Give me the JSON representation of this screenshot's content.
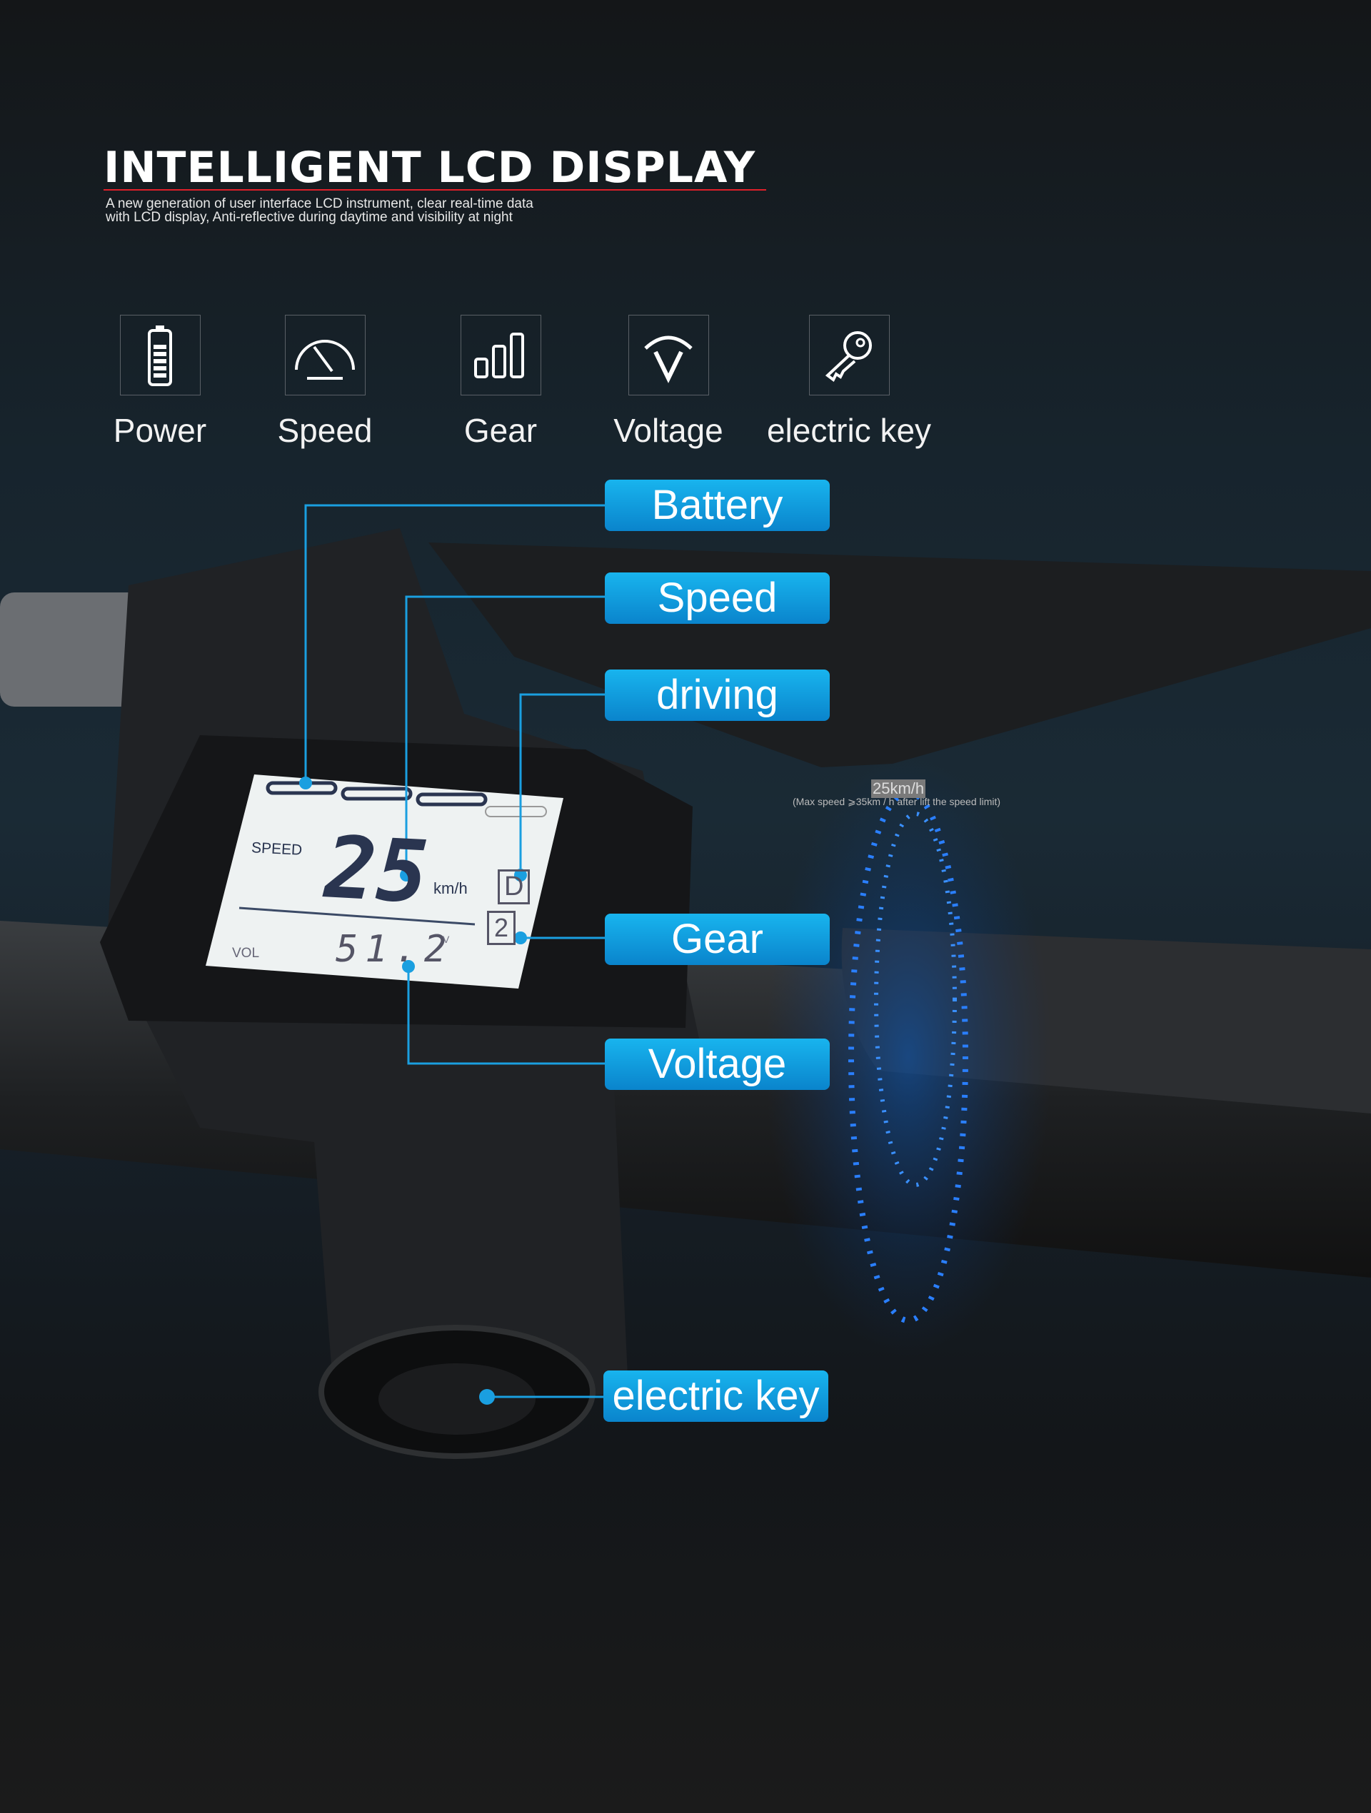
{
  "header": {
    "title": "INTELLIGENT LCD DISPLAY",
    "subtitle_lines": [
      "A new generation of user interface LCD instrument, clear real-time data",
      "with LCD display, Anti-reflective during daytime and visibility at night"
    ],
    "accent": "#e0202a"
  },
  "features": [
    {
      "icon": "battery-icon",
      "label": "Power"
    },
    {
      "icon": "speedometer-icon",
      "label": "Speed"
    },
    {
      "icon": "signal-bars-icon",
      "label": "Gear"
    },
    {
      "icon": "voltage-icon",
      "label": "Voltage"
    },
    {
      "icon": "key-icon",
      "label": "electric key"
    }
  ],
  "callouts": {
    "battery": "Battery",
    "speed": "Speed",
    "driving": "driving",
    "gear": "Gear",
    "voltage": "Voltage",
    "electric_key": "electric key",
    "color": "#0a9ad8"
  },
  "lcd": {
    "speed_label": "SPEED",
    "speed": "25",
    "unit": "km/h",
    "mode": "D",
    "gear": "2",
    "vol_label": "VOL",
    "voltage": "51.2",
    "vol_unit": "V",
    "battery_bars_filled": 3,
    "battery_bars_total": 4
  },
  "speed_limit": {
    "value": "25km/h",
    "note": "(Max speed ⩾35km / h after lift the speed limit)"
  }
}
